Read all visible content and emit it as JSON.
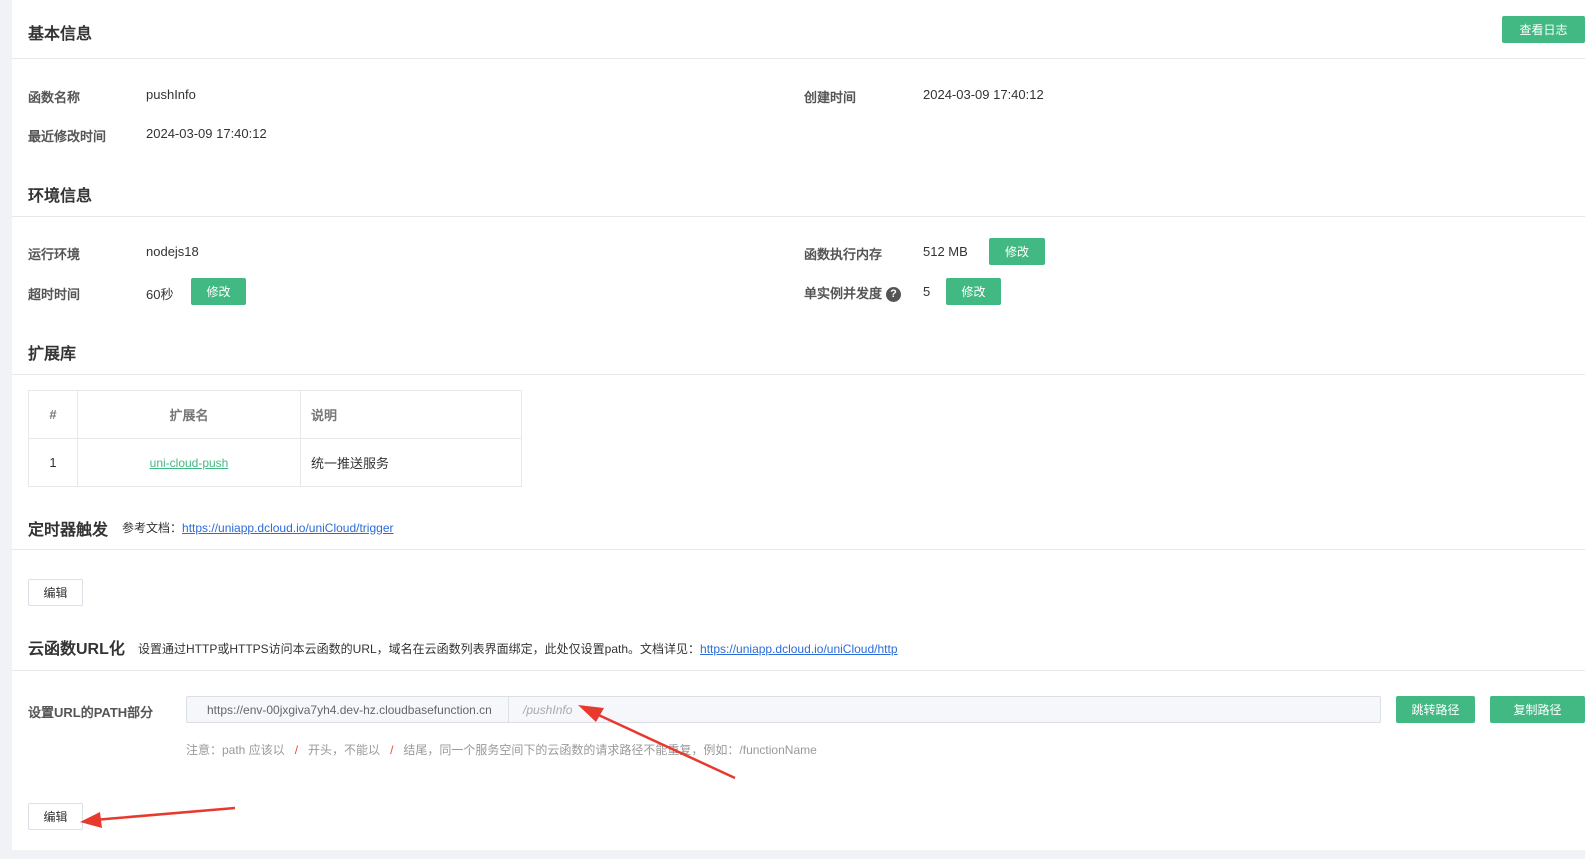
{
  "basic": {
    "title": "基本信息",
    "view_log_button": "查看日志",
    "function_name_label": "函数名称",
    "function_name": "pushInfo",
    "created_label": "创建时间",
    "created": "2024-03-09 17:40:12",
    "modified_label": "最近修改时间",
    "modified": "2024-03-09 17:40:12"
  },
  "env": {
    "title": "环境信息",
    "runtime_label": "运行环境",
    "runtime": "nodejs18",
    "memory_label": "函数执行内存",
    "memory": "512 MB",
    "memory_edit": "修改",
    "timeout_label": "超时时间",
    "timeout": "60秒",
    "timeout_edit": "修改",
    "concurrency_label": "单实例并发度",
    "concurrency_help": "?",
    "concurrency": "5",
    "concurrency_edit": "修改"
  },
  "extensions": {
    "title": "扩展库",
    "headers": [
      "#",
      "扩展名",
      "说明"
    ],
    "rows": [
      {
        "index": "1",
        "name": "uni-cloud-push",
        "desc": "统一推送服务"
      }
    ]
  },
  "timer": {
    "title": "定时器触发",
    "ref_label": "参考文档：",
    "ref_link": "https://uniapp.dcloud.io/uniCloud/trigger",
    "edit_button": "编辑"
  },
  "url": {
    "title": "云函数URL化",
    "desc": "设置通过HTTP或HTTPS访问本云函数的URL，域名在云函数列表界面绑定，此处仅设置path。文档详见：",
    "doc_link": "https://uniapp.dcloud.io/uniCloud/http",
    "path_label": "设置URL的PATH部分",
    "prefix": "https://env-00jxgiva7yh4.dev-hz.cloudbasefunction.cn",
    "path": "/pushInfo",
    "jump_button": "跳转路径",
    "copy_button": "复制路径",
    "hint_a": "注意：path 应该以",
    "hint_slash1": "/",
    "hint_b": "开头，不能以",
    "hint_slash2": "/",
    "hint_c": "结尾，同一个服务空间下的云函数的请求路径不能重复，例如：/functionName",
    "edit_button": "编辑"
  },
  "colors": {
    "accent": "#42b983",
    "link": "#2b6cd9",
    "arrow": "#e8392f"
  }
}
